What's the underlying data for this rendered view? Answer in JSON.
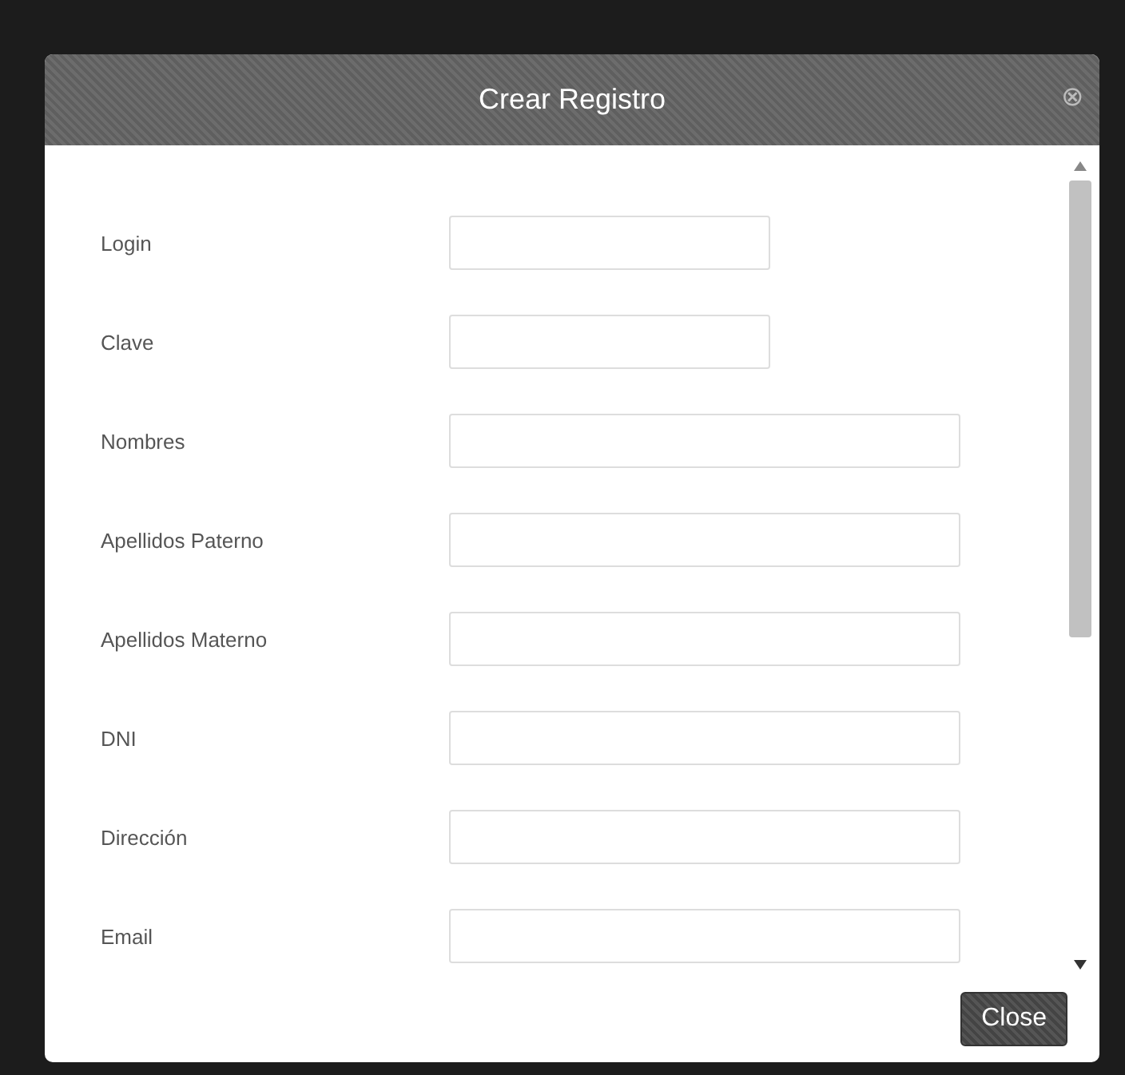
{
  "dialog": {
    "title": "Crear Registro",
    "close_icon": "⊗"
  },
  "fields": [
    {
      "label": "Login",
      "kind": "short"
    },
    {
      "label": "Clave",
      "kind": "short"
    },
    {
      "label": "Nombres",
      "kind": "long"
    },
    {
      "label": "Apellidos Paterno",
      "kind": "long"
    },
    {
      "label": "Apellidos Materno",
      "kind": "long"
    },
    {
      "label": "DNI",
      "kind": "long"
    },
    {
      "label": "Dirección",
      "kind": "long"
    },
    {
      "label": "Email",
      "kind": "long"
    }
  ],
  "buttons": [
    "Close"
  ]
}
